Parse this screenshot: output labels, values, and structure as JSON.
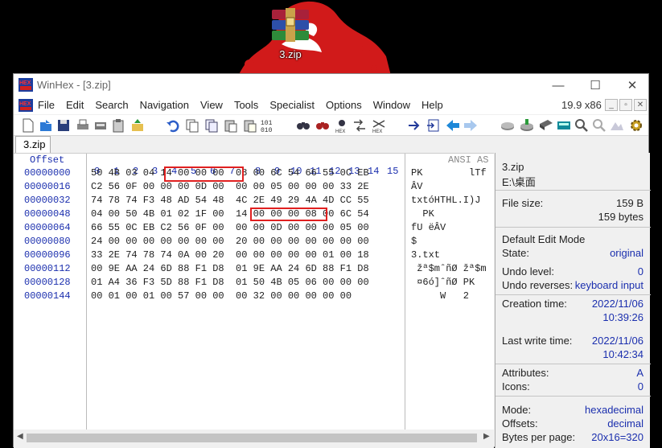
{
  "desktop": {
    "icon_label": "3.zip"
  },
  "window": {
    "title": "WinHex - [3.zip]",
    "min_glyph": "—",
    "max_glyph": "☐",
    "close_glyph": "✕"
  },
  "menu": {
    "items": [
      "File",
      "Edit",
      "Search",
      "Navigation",
      "View",
      "Tools",
      "Specialist",
      "Options",
      "Window",
      "Help"
    ],
    "version": "19.9 x86"
  },
  "toolbar": {
    "icons": [
      "new-file-icon",
      "open-file-icon",
      "save-icon",
      "print-icon",
      "properties-icon",
      "clipboard-icon",
      "export-icon",
      "undo-icon",
      "copy-icon",
      "copy-block-icon",
      "paste-icon",
      "paste-write-icon",
      "hex-convert-icon",
      "find-icon",
      "find-text-icon",
      "find-hex-icon",
      "replace-text-icon",
      "replace-hex-icon",
      "goto-offset-icon",
      "goto-sector-icon",
      "back-icon",
      "forward-icon",
      "disk-icon",
      "disk-edit-icon",
      "ram-icon",
      "calculator-icon",
      "hash-icon",
      "analyze-icon",
      "debug-icon",
      "settings-icon"
    ]
  },
  "tab": {
    "label": "3.zip"
  },
  "hex": {
    "offset_header": "Offset",
    "column_header": " 0  1  2  3  4  5  6  7   8  9 10 11 12 13 14 15",
    "ansi_header": "ANSI AS",
    "rows": [
      {
        "offset": "00000000",
        "hex": "50 4B 03 04 14 00 00 00  08 00 6C 54 66 55 0C EB",
        "ansi": "PK        lTf"
      },
      {
        "offset": "00000016",
        "hex": "C2 56 0F 00 00 00 0D 00  00 00 05 00 00 00 33 2E",
        "ansi": "ÂV"
      },
      {
        "offset": "00000032",
        "hex": "74 78 74 F3 48 AD 54 48  4C 2E 49 29 4A 4D CC 55",
        "ansi": "txtóH­THL.I)J"
      },
      {
        "offset": "00000048",
        "hex": "04 00 50 4B 01 02 1F 00  14 00 00 00 08 00 6C 54",
        "ansi": "  PK"
      },
      {
        "offset": "00000064",
        "hex": "66 55 0C EB C2 56 0F 00  00 00 0D 00 00 00 05 00",
        "ansi": "fU ëÂV"
      },
      {
        "offset": "00000080",
        "hex": "24 00 00 00 00 00 00 00  20 00 00 00 00 00 00 00",
        "ansi": "$"
      },
      {
        "offset": "00000096",
        "hex": "33 2E 74 78 74 0A 00 20  00 00 00 00 00 01 00 18",
        "ansi": "3.txt"
      },
      {
        "offset": "00000112",
        "hex": "00 9E AA 24 6D 88 F1 D8  01 9E AA 24 6D 88 F1 D8",
        "ansi": " žª$mˆñØ žª$m"
      },
      {
        "offset": "00000128",
        "hex": "01 A4 36 F3 5D 88 F1 D8  01 50 4B 05 06 00 00 00",
        "ansi": " ¤6ó]ˆñØ PK"
      },
      {
        "offset": "00000144",
        "hex": "00 01 00 01 00 57 00 00  00 32 00 00 00 00 00",
        "ansi": "     W   2"
      }
    ]
  },
  "info": {
    "file_name": "3.zip",
    "path": "E:\\桌面",
    "file_size_label": "File size:",
    "file_size": "159 B",
    "file_size_bytes": "159 bytes",
    "edit_mode_label": "Default Edit Mode",
    "state_label": "State:",
    "state": "original",
    "undo_level_label": "Undo level:",
    "undo_level": "0",
    "undo_reverses_label": "Undo reverses:",
    "undo_reverses": "keyboard input",
    "creation_label": "Creation time:",
    "creation_date": "2022/11/06",
    "creation_time": "10:39:26",
    "write_label": "Last write time:",
    "write_date": "2022/11/06",
    "write_time": "10:42:34",
    "attributes_label": "Attributes:",
    "attributes": "A",
    "icons_label": "Icons:",
    "icons": "0",
    "mode_label": "Mode:",
    "mode": "hexadecimal",
    "offsets_label": "Offsets:",
    "offsets": "decimal",
    "bpp_label": "Bytes per page:",
    "bpp": "20x16=320"
  },
  "colors": {
    "highlight_box": "#e02020",
    "offset_blue": "#1b2fae"
  }
}
